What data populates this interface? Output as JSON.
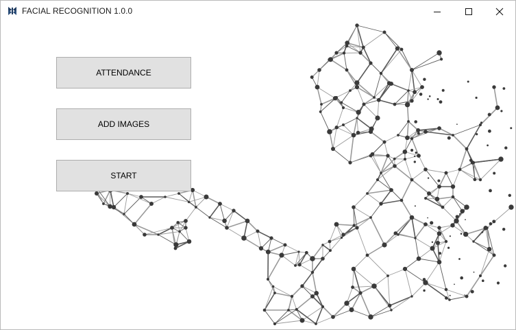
{
  "window": {
    "title": "FACIAL RECOGNITION 1.0.0",
    "app_icon": "kivy-logo-icon",
    "controls": [
      "minimize-icon",
      "maximize-icon",
      "close-icon"
    ]
  },
  "buttons": {
    "attendance": "ATTENDANCE",
    "add_images": "ADD IMAGES",
    "start": "START"
  },
  "background": {
    "image": "low-poly-network-human-figure",
    "colors": {
      "line": "#8a8a8a",
      "node": "#3a3a3a",
      "button": "#e1e1e1",
      "button_border": "#adadad"
    }
  }
}
